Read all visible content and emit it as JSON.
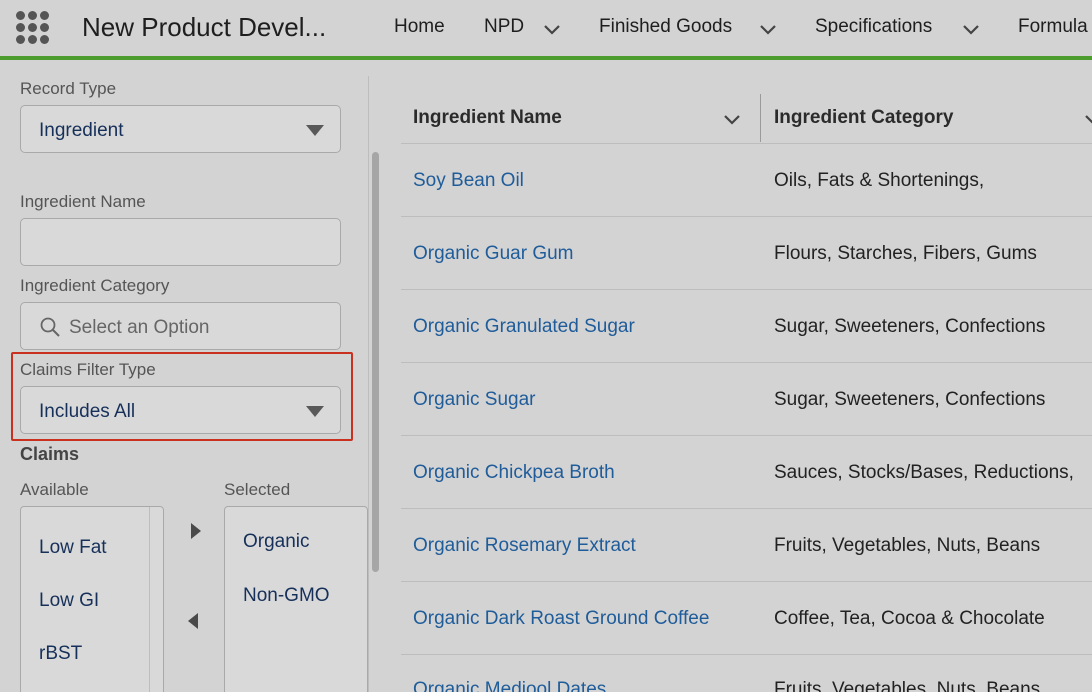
{
  "header": {
    "app_name": "New Product Devel...",
    "nav": [
      {
        "label": "Home",
        "has_menu": false
      },
      {
        "label": "NPD",
        "has_menu": true
      },
      {
        "label": "Finished Goods",
        "has_menu": true
      },
      {
        "label": "Specifications",
        "has_menu": true
      },
      {
        "label": "Formula",
        "has_menu": false
      }
    ],
    "accent_color": "#4c9c2e"
  },
  "filters": {
    "record_type": {
      "label": "Record Type",
      "value": "Ingredient"
    },
    "ingredient_name": {
      "label": "Ingredient Name",
      "value": ""
    },
    "ingredient_category": {
      "label": "Ingredient Category",
      "placeholder": "Select an Option"
    },
    "claims_filter_type": {
      "label": "Claims Filter Type",
      "value": "Includes All"
    },
    "claims": {
      "title": "Claims",
      "available_label": "Available",
      "selected_label": "Selected",
      "available": [
        "Low Fat",
        "Low GI",
        "rBST"
      ],
      "selected": [
        "Organic",
        "Non-GMO"
      ]
    },
    "highlight_color": "#c9301f"
  },
  "table": {
    "columns": [
      "Ingredient Name",
      "Ingredient Category"
    ],
    "rows": [
      {
        "name": "Soy Bean Oil",
        "category": "Oils, Fats & Shortenings,"
      },
      {
        "name": "Organic Guar Gum",
        "category": "Flours, Starches, Fibers, Gums"
      },
      {
        "name": "Organic Granulated Sugar",
        "category": "Sugar, Sweeteners, Confections"
      },
      {
        "name": "Organic Sugar",
        "category": "Sugar, Sweeteners, Confections"
      },
      {
        "name": "Organic Chickpea Broth",
        "category": "Sauces, Stocks/Bases, Reductions,"
      },
      {
        "name": "Organic Rosemary Extract",
        "category": "Fruits, Vegetables, Nuts, Beans"
      },
      {
        "name": "Organic Dark Roast Ground Coffee",
        "category": "Coffee, Tea, Cocoa & Chocolate"
      },
      {
        "name": "Organic Medjool Dates",
        "category": "Fruits, Vegetables, Nuts, Beans"
      }
    ],
    "link_color": "#1f5c9a"
  }
}
